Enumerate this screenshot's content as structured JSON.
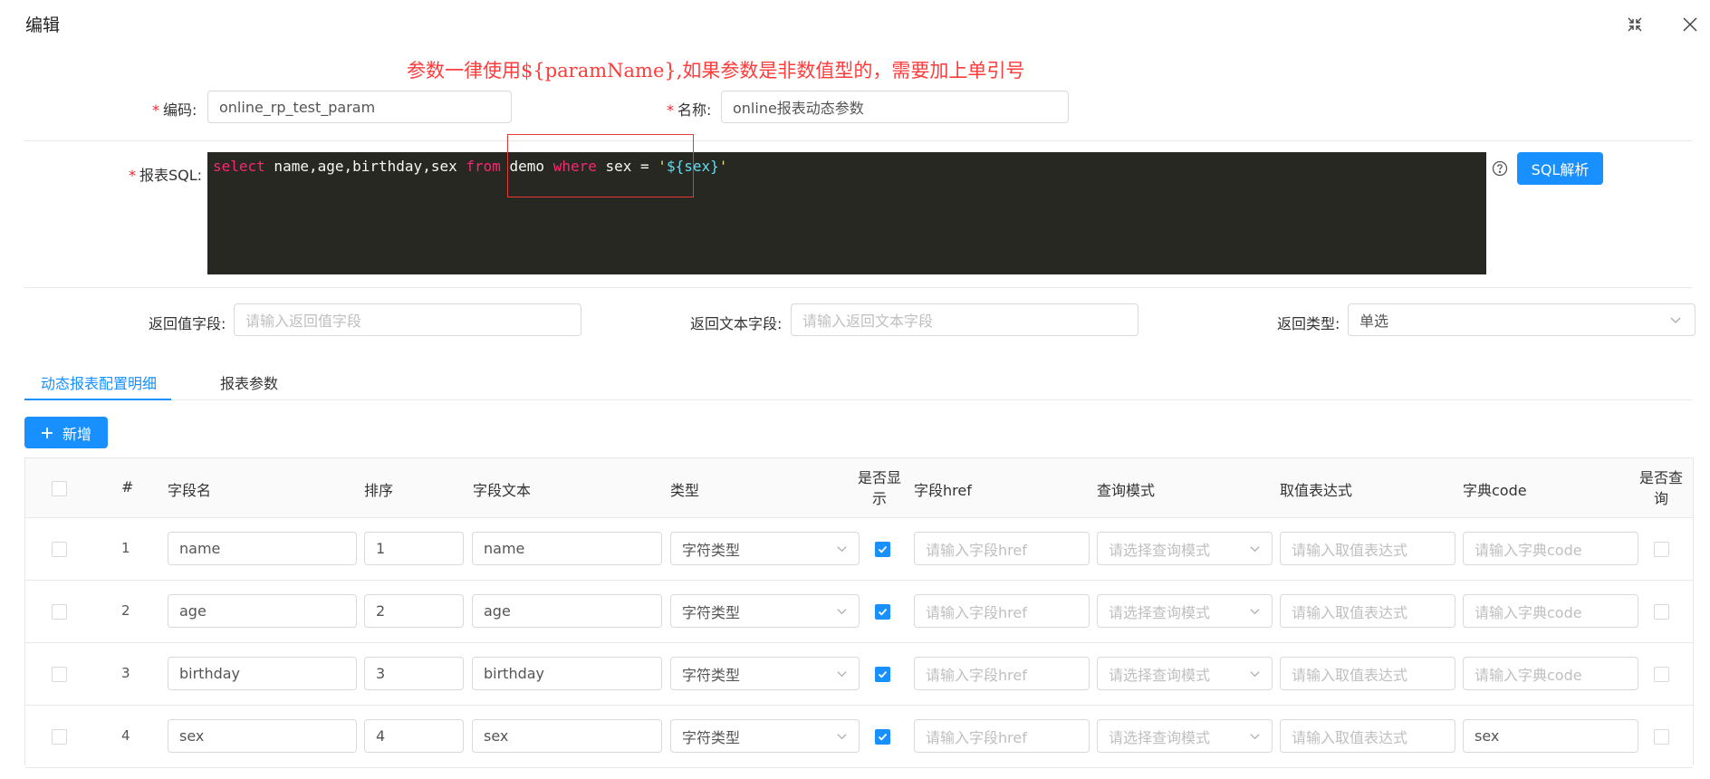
{
  "modal": {
    "title": "编辑",
    "note": "参数一律使用${paramName},如果参数是非数值型的，需要加上单引号"
  },
  "form": {
    "code_label": "编码",
    "code_value": "online_rp_test_param",
    "name_label": "名称",
    "name_value": "online报表动态参数",
    "sql_label": "报表SQL",
    "sql_tokens": [
      {
        "type": "kw",
        "text": "select"
      },
      {
        "type": "plain",
        "text": " name,age,birthday,sex "
      },
      {
        "type": "kw",
        "text": "from"
      },
      {
        "type": "plain",
        "text": " demo "
      },
      {
        "type": "kw",
        "text": "where"
      },
      {
        "type": "plain",
        "text": " sex = "
      },
      {
        "type": "str",
        "text": "'"
      },
      {
        "type": "var",
        "text": "${sex}"
      },
      {
        "type": "str",
        "text": "'"
      }
    ],
    "sql_parse_button": "SQL解析",
    "return_value_label": "返回值字段",
    "return_value_placeholder": "请输入返回值字段",
    "return_text_label": "返回文本字段",
    "return_text_placeholder": "请输入返回文本字段",
    "return_type_label": "返回类型",
    "return_type_value": "单选",
    "colon": ":"
  },
  "tabs": [
    {
      "label": "动态报表配置明细",
      "active": true
    },
    {
      "label": "报表参数",
      "active": false
    }
  ],
  "add_button": "新增",
  "table": {
    "headers": {
      "index": "#",
      "field_name": "字段名",
      "order": "排序",
      "field_text": "字段文本",
      "type": "类型",
      "show": "是否显示",
      "href": "字段href",
      "query_mode": "查询模式",
      "expression": "取值表达式",
      "dict_code": "字典code",
      "is_query": "是否查询"
    },
    "placeholders": {
      "href": "请输入字段href",
      "query_mode": "请选择查询模式",
      "expression": "请输入取值表达式",
      "dict_code": "请输入字典code"
    },
    "rows": [
      {
        "index": "1",
        "field_name": "name",
        "order": "1",
        "field_text": "name",
        "type": "字符类型",
        "show": true,
        "dict_code": "",
        "is_query": false
      },
      {
        "index": "2",
        "field_name": "age",
        "order": "2",
        "field_text": "age",
        "type": "字符类型",
        "show": true,
        "dict_code": "",
        "is_query": false
      },
      {
        "index": "3",
        "field_name": "birthday",
        "order": "3",
        "field_text": "birthday",
        "type": "字符类型",
        "show": true,
        "dict_code": "",
        "is_query": false
      },
      {
        "index": "4",
        "field_name": "sex",
        "order": "4",
        "field_text": "sex",
        "type": "字符类型",
        "show": true,
        "dict_code": "sex",
        "is_query": false
      }
    ]
  },
  "colors": {
    "primary": "#1890ff",
    "required": "#f5222d",
    "note": "#ff3b3b",
    "editor_bg": "#272822",
    "highlight_box": "#e53935"
  }
}
